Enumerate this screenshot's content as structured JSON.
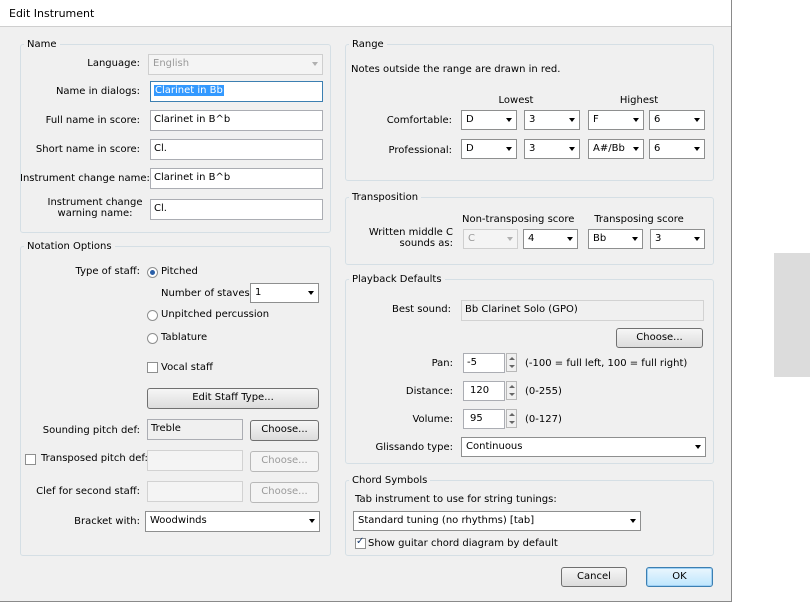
{
  "window": {
    "title": "Edit Instrument"
  },
  "name_group": {
    "title": "Name",
    "language_label": "Language:",
    "language_value": "English",
    "dialog_name_label": "Name in dialogs:",
    "dialog_name_value": "Clarinet in Bb",
    "full_name_label": "Full name in score:",
    "full_name_value": "Clarinet in B^b",
    "short_name_label": "Short name in score:",
    "short_name_value": "Cl.",
    "change_name_label": "Instrument change name:",
    "change_name_value": "Clarinet in B^b",
    "warning_name_label_1": "Instrument change",
    "warning_name_label_2": "warning name:",
    "warning_name_value": "Cl."
  },
  "notation_group": {
    "title": "Notation Options",
    "type_label": "Type of staff:",
    "pitched_label": "Pitched",
    "pitched_checked": true,
    "staves_label": "Number of staves:",
    "staves_value": "1",
    "unpitched_label": "Unpitched percussion",
    "tablature_label": "Tablature",
    "vocal_label": "Vocal staff",
    "vocal_checked": false,
    "edit_staff_button": "Edit Staff Type...",
    "sounding_label": "Sounding pitch def:",
    "sounding_value": "Treble",
    "sounding_choose": "Choose...",
    "transposed_label": "Transposed pitch def:",
    "transposed_value": "",
    "transposed_choose": "Choose...",
    "clef_second_label": "Clef for second staff:",
    "clef_second_value": "",
    "clef_second_choose": "Choose...",
    "bracket_label": "Bracket with:",
    "bracket_value": "Woodwinds"
  },
  "range_group": {
    "title": "Range",
    "note": "Notes outside the range are drawn in red.",
    "lowest_label": "Lowest",
    "highest_label": "Highest",
    "comfortable_label": "Comfortable:",
    "comfortable_low_note": "D",
    "comfortable_low_octave": "3",
    "comfortable_high_note": "F",
    "comfortable_high_octave": "6",
    "professional_label": "Professional:",
    "professional_low_note": "D",
    "professional_low_octave": "3",
    "professional_high_note": "A#/Bb",
    "professional_high_octave": "6"
  },
  "transposition_group": {
    "title": "Transposition",
    "label_1": "Written middle C",
    "label_2": "sounds as:",
    "non_transposing_label": "Non-transposing score",
    "transposing_label": "Transposing score",
    "non_trans_note": "C",
    "non_trans_octave": "4",
    "trans_note": "Bb",
    "trans_octave": "3"
  },
  "playback_group": {
    "title": "Playback Defaults",
    "best_sound_label": "Best sound:",
    "best_sound_value": "Bb Clarinet Solo (GPO)",
    "choose_button": "Choose...",
    "pan_label": "Pan:",
    "pan_value": "-5",
    "pan_hint": "(-100 = full left, 100 = full right)",
    "distance_label": "Distance:",
    "distance_value": "120",
    "distance_hint": "(0-255)",
    "volume_label": "Volume:",
    "volume_value": "95",
    "volume_hint": "(0-127)",
    "glissando_label": "Glissando type:",
    "glissando_value": "Continuous"
  },
  "chord_group": {
    "title": "Chord Symbols",
    "tab_label": "Tab instrument to use for string tunings:",
    "tab_value": "Standard tuning (no rhythms) [tab]",
    "show_diagram_label": "Show guitar chord diagram by default",
    "show_diagram_checked": true
  },
  "footer": {
    "cancel_label": "Cancel",
    "ok_label": "OK"
  }
}
